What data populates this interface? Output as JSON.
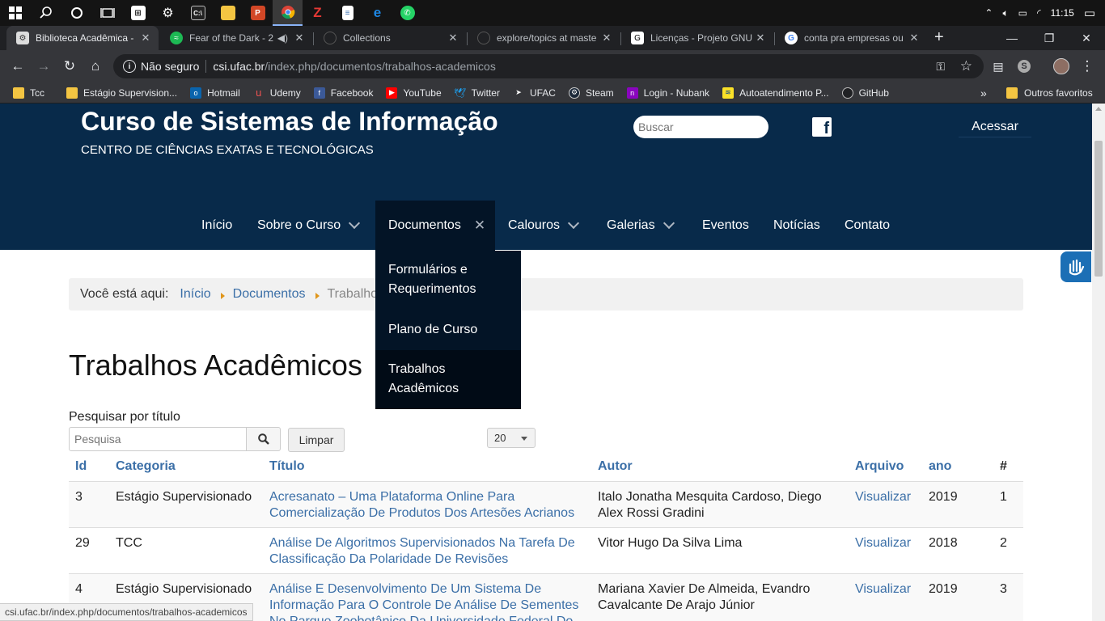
{
  "taskbar": {
    "clock": "11:15",
    "apps": [
      {
        "icon": "windows-start-icon"
      },
      {
        "icon": "search-icon"
      },
      {
        "icon": "cortana-icon"
      },
      {
        "icon": "task-view-icon"
      },
      {
        "icon": "store-icon"
      },
      {
        "icon": "settings-gear-icon"
      },
      {
        "icon": "terminal-icon"
      },
      {
        "icon": "file-explorer-icon"
      },
      {
        "icon": "powerpoint-icon"
      },
      {
        "icon": "chrome-icon"
      },
      {
        "icon": "filezilla-icon"
      },
      {
        "icon": "notepad-icon"
      },
      {
        "icon": "edge-icon"
      },
      {
        "icon": "whatsapp-icon"
      }
    ]
  },
  "browser": {
    "tabs": [
      {
        "title": "Biblioteca Acadêmica -",
        "active": true
      },
      {
        "title": "Fear of the Dark - 2",
        "playing": true
      },
      {
        "title": "Collections"
      },
      {
        "title": "explore/topics at maste"
      },
      {
        "title": "Licenças - Projeto GNU"
      },
      {
        "title": "conta pra empresas ou"
      }
    ],
    "new_tab": "+",
    "security_label": "Não seguro",
    "url_host": "csi.ufac.br",
    "url_path": "/index.php/documentos/trabalhos-academicos",
    "bookmarks": [
      "Tcc",
      "Estágio Supervision...",
      "Hotmail",
      "Udemy",
      "Facebook",
      "YouTube",
      "Twitter",
      "UFAC",
      "Steam",
      "Login - Nubank",
      "Autoatendimento P...",
      "GitHub"
    ],
    "bookmarks_overflow": "»",
    "other_bookmarks": "Outros favoritos",
    "status_url": "csi.ufac.br/index.php/documentos/trabalhos-academicos"
  },
  "site": {
    "title": "Curso de Sistemas de Informação",
    "subtitle": "CENTRO DE CIÊNCIAS EXATAS E TECNOLÓGICAS",
    "search_placeholder": "Buscar",
    "login": "Acessar",
    "nav": [
      "Início",
      "Sobre o Curso",
      "Documentos",
      "Calouros",
      "Galerias",
      "Eventos",
      "Notícias",
      "Contato"
    ],
    "dropdown": [
      "Formulários e Requerimentos",
      "Plano de Curso",
      "Trabalhos Acadêmicos"
    ]
  },
  "breadcrumb": {
    "prefix": "Você está aqui:",
    "items": [
      "Início",
      "Documentos",
      "Trabalhos Acadêmicos"
    ]
  },
  "content": {
    "heading": "Trabalhos Acadêmicos",
    "search_label": "Pesquisar por título",
    "search_placeholder": "Pesquisa",
    "clear_button": "Limpar",
    "page_limit": "20",
    "columns": [
      "Id",
      "Categoria",
      "Título",
      "Autor",
      "Arquivo",
      "ano",
      "#"
    ],
    "rows": [
      {
        "id": "3",
        "category": "Estágio Supervisionado",
        "title": [
          "Acresanato – Uma Plataforma Online Para",
          "Comercialização De Produtos Dos Artesões Acrianos"
        ],
        "author": [
          "Italo Jonatha Mesquita Cardoso, Diego",
          "Alex Rossi Gradini"
        ],
        "file": "Visualizar",
        "year": "2019",
        "n": "1"
      },
      {
        "id": "29",
        "category": "TCC",
        "title": [
          "Análise De Algoritmos Supervisionados Na Tarefa De",
          "Classificação Da Polaridade De Revisões"
        ],
        "author": [
          "Vitor Hugo Da Silva Lima",
          ""
        ],
        "file": "Visualizar",
        "year": "2018",
        "n": "2"
      },
      {
        "id": "4",
        "category": "Estágio Supervisionado",
        "title": [
          "Análise E Desenvolvimento De Um Sistema De",
          "Informação Para O Controle De Análise De Sementes",
          "No Parque Zoobotânico Da Universidade Federal Do"
        ],
        "author": [
          "Mariana Xavier De Almeida, Evandro",
          "Cavalcante De Arajo Júnior"
        ],
        "file": "Visualizar",
        "year": "2019",
        "n": "3"
      }
    ]
  },
  "colors": {
    "header_bg": "#082a4a",
    "dropdown_bg": "#031426",
    "link": "#3b6fa7",
    "breadcrumb_arrow": "#e0961b"
  }
}
